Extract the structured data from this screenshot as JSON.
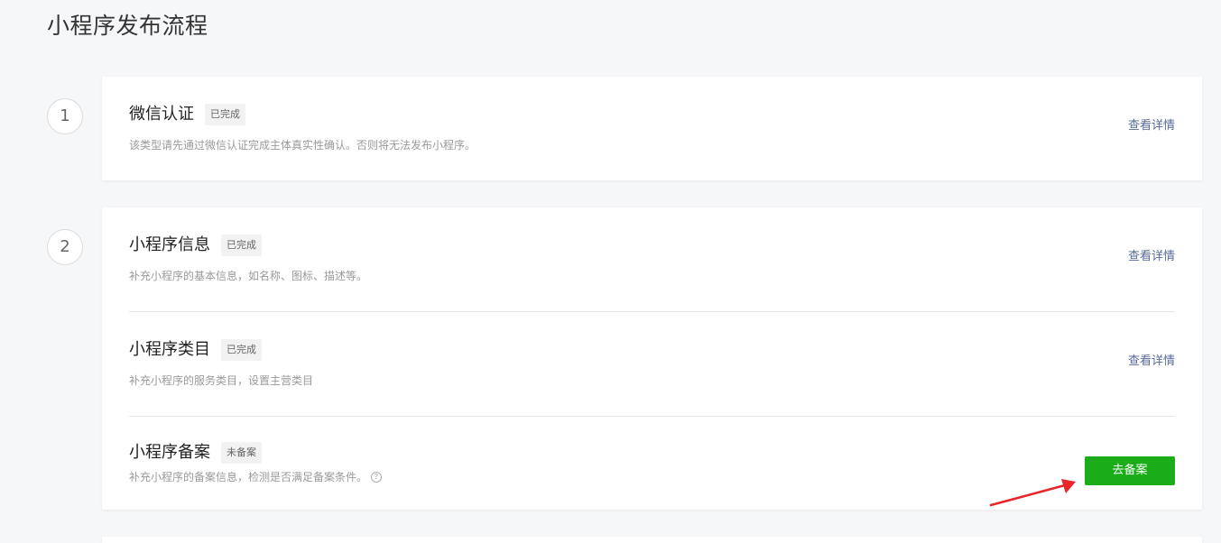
{
  "page": {
    "title": "小程序发布流程"
  },
  "steps": [
    {
      "number": "1",
      "items": [
        {
          "title": "微信认证",
          "status": "已完成",
          "description": "该类型请先通过微信认证完成主体真实性确认。否则将无法发布小程序。",
          "action": "查看详情"
        }
      ]
    },
    {
      "number": "2",
      "items": [
        {
          "title": "小程序信息",
          "status": "已完成",
          "description": "补充小程序的基本信息，如名称、图标、描述等。",
          "action": "查看详情"
        },
        {
          "title": "小程序类目",
          "status": "已完成",
          "description": "补充小程序的服务类目，设置主营类目",
          "action": "查看详情"
        },
        {
          "title": "小程序备案",
          "status": "未备案",
          "description": "补充小程序的备案信息，检测是否满足备案条件。",
          "action": "去备案"
        }
      ]
    }
  ],
  "colors": {
    "primary_button": "#1aad19",
    "link": "#576b95",
    "annotation_arrow": "#e8262a"
  },
  "icons": {
    "help": "question-circle-icon",
    "annotation": "red-arrow-icon"
  }
}
